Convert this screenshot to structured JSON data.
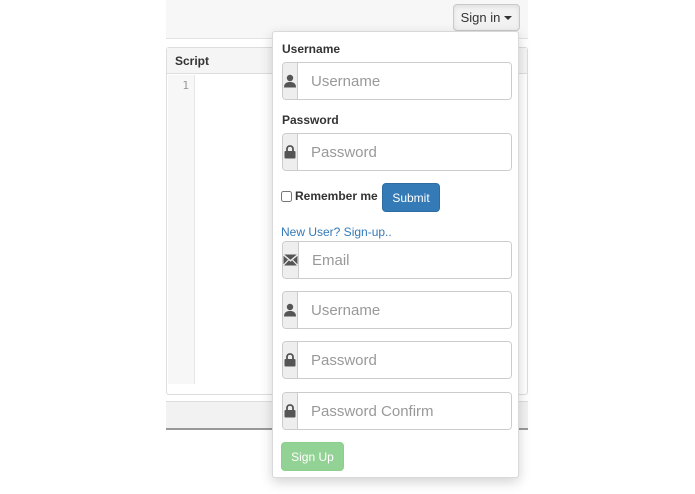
{
  "navbar": {
    "signin_label": "Sign in"
  },
  "script_panel": {
    "title": "Script",
    "line_numbers": [
      "1"
    ]
  },
  "login": {
    "username_label": "Username",
    "username_placeholder": "Username",
    "password_label": "Password",
    "password_placeholder": "Password",
    "remember_label": "Remember me",
    "submit_label": "Submit"
  },
  "signup": {
    "link_text": "New User? Sign-up..",
    "email_placeholder": "Email",
    "username_placeholder": "Username",
    "password_placeholder": "Password",
    "password_confirm_placeholder": "Password Confirm",
    "button_label": "Sign Up"
  },
  "colors": {
    "primary": "#337ab7",
    "success_disabled": "#92d294",
    "icon": "#555555"
  }
}
